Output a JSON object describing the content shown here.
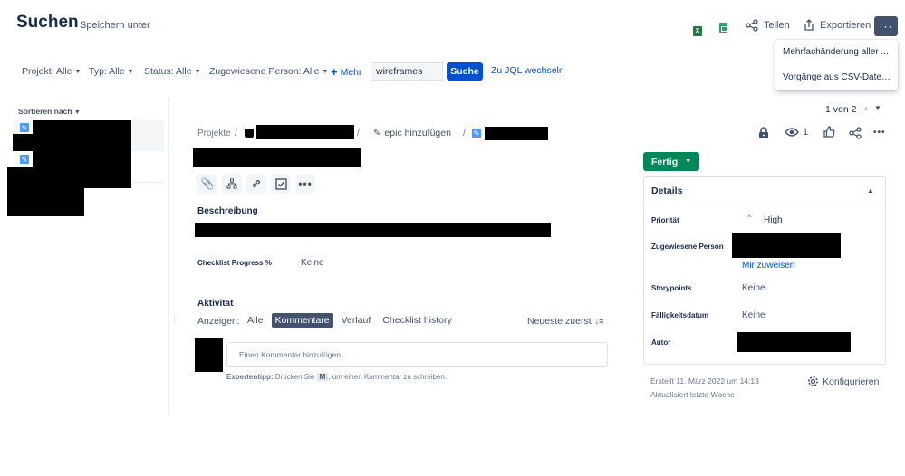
{
  "header": {
    "title": "Suchen",
    "save_under": "Speichern unter",
    "share": "Teilen",
    "export": "Exportieren",
    "more": "···",
    "menu": [
      "Mehrfachänderung aller ...",
      "Vorgänge aus CSV-Datei ..."
    ]
  },
  "filters": {
    "project": "Projekt: Alle",
    "type": "Typ: Alle",
    "status": "Status: Alle",
    "assignee": "Zugewiesene Person: Alle",
    "more": "Mehr",
    "search_value": "wireframes",
    "search_button": "Suche",
    "jql": "Zu JQL wechseln"
  },
  "list": {
    "sort_label": "Sortieren nach"
  },
  "issue": {
    "breadcrumb_projects": "Projekte",
    "breadcrumb_sep": "/",
    "add_epic": "epic hinzufügen",
    "pager": "1 von 2",
    "watchers": "1",
    "description_heading": "Beschreibung",
    "checklist_label": "Checklist Progress %",
    "checklist_value": "Keine",
    "activity_heading": "Aktivität",
    "show_label": "Anzeigen:",
    "tabs": [
      "Alle",
      "Kommentare",
      "Verlauf",
      "Checklist history"
    ],
    "sort_newest": "Neueste zuerst",
    "comment_placeholder": "Einen Kommentar hinzufügen...",
    "tip_bold": "Expertentipp:",
    "tip_pre": "Drücken Sie",
    "tip_key": "M",
    "tip_post": ", um einen Kommentar zu schreiben."
  },
  "sidebar": {
    "status": "Fertig",
    "details_heading": "Details",
    "priority_label": "Priorität",
    "priority_value": "High",
    "assignee_label": "Zugewiesene Person",
    "assign_me": "Mir zuweisen",
    "storypoints_label": "Storypoints",
    "storypoints_value": "Keine",
    "due_label": "Fälligkeitsdatum",
    "due_value": "Keine",
    "author_label": "Autor",
    "created": "Erstellt 11. März 2022 um 14:13",
    "updated": "Aktualisiert letzte Woche",
    "configure": "Konfigurieren"
  },
  "colors": {
    "primary": "#0052cc",
    "done": "#00875a",
    "priority_high": "#ff7452"
  }
}
